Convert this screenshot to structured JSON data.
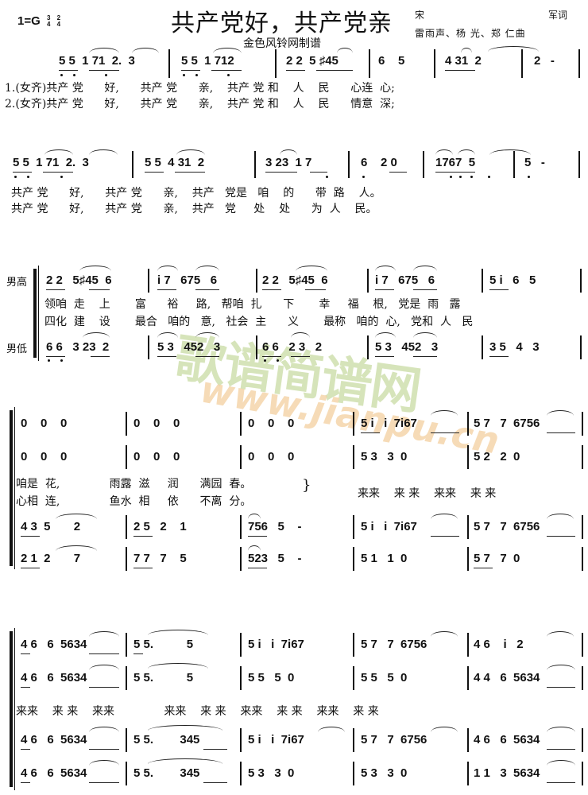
{
  "header": {
    "key_signature": "1=G",
    "time_sig_1": {
      "num": "3",
      "den": "4"
    },
    "time_sig_2": {
      "num": "2",
      "den": "4"
    },
    "title": "共产党好，共产党亲",
    "subtitle": "金色风铃网制谱",
    "lyricist_name": "宋",
    "lyricist_role": "军词",
    "composers": "雷雨声、杨 光、郑 仁曲"
  },
  "watermark": {
    "text_cn": "歌谱简谱网",
    "text_url": "www.jianpu.cn",
    "color_green": "#c8d9a0",
    "color_orange": "#f3cfa0"
  },
  "system1": {
    "measures": [
      "5 5  1 71  2.  3",
      "5 5  1 712",
      "2 2  5 ♯45",
      "6    5",
      "4 31  2",
      "2   -"
    ],
    "verse1": "1.(女齐)共产 党      好,      共产 党      亲,    共产 党 和    人    民      心连  心;",
    "verse2": "2.(女齐)共产 党      好,      共产 党      亲,    共产 党 和    人    民      情意  深;"
  },
  "system2": {
    "measures": [
      "5 5  1 71  2.  3",
      "5 5  4 31  2",
      "3 23  1 7",
      "6    2 0",
      "1767  5",
      "5   -"
    ],
    "verse1": "共产 党      好,      共产 党      亲,    共产   党是   咱    的      带  路    人。",
    "verse2": "共产 党      好,      共产 党      亲,    共产   党     处    处      为  人    民。"
  },
  "system3": {
    "label_high": "男高",
    "label_low": "男低",
    "high_measures": [
      "2 2   5♯45  6",
      "i 7   675   6",
      "2 2   5♯45  6",
      "i 7   675   6",
      "5 i   6   5"
    ],
    "verse1": "领咱  走    上       富      裕     路,   帮咱  扎      下       幸     福    根,   党是  雨   露",
    "verse2": "四化  建    设       最合   咱的   意,   社会  主      义       最称   咱的  心,   党和  人   民",
    "low_measures": [
      "6 6   3 23  2",
      "5 3   452   3",
      "6 6   2 3   2",
      "5 3   452   3",
      "3 5   4   3"
    ]
  },
  "system4": {
    "row1": [
      "0    0    0",
      "0    0    0",
      "0    0    0",
      "5 i   i  7i67",
      "5 7   7  6756"
    ],
    "row2": [
      "0    0    0",
      "0    0    0",
      "0    0    0",
      "5 3   3  0",
      "5 2   2  0"
    ],
    "verse1": "咱是  花,              雨露  滋     润      满园  春。",
    "verse2": "心相  连,              鱼水  相     依      不离  分。",
    "lai": "来来    来 来    来来    来 来",
    "row4": [
      "4 3  5       2",
      "2 5   2    1",
      "756   5    -",
      "5 i   i  7i67",
      "5 7   7  6756"
    ],
    "row5": [
      "2 1  2       7",
      "7 7   7    5",
      "523   5    -",
      "5 1   1  0",
      "5 7   7  0"
    ]
  },
  "system5": {
    "row1": [
      "4 6   6  5634",
      "5 5.          5",
      "5 i   i  7i67",
      "5 7   7  6756",
      "4 6    i   2"
    ],
    "row2": [
      "4 6   6  5634",
      "5 5.          5",
      "5 5   5  0",
      "5 5   5  0",
      "4 4   6  5634"
    ],
    "lai": "来来    来 来    来来              来来    来 来    来来    来 来    来来    来 来",
    "row4": [
      "4 6   6  5634",
      "5 5.        345",
      "5 i   i  7i67",
      "5 7   7  6756",
      "4 6   6  5634"
    ],
    "row5": [
      "4 6   6  5634",
      "5 5.        345",
      "5 3   3  0",
      "5 3   3  0",
      "1 1   3  5634"
    ]
  }
}
